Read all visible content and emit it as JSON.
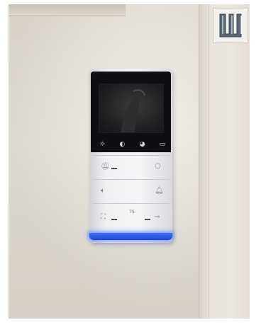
{
  "photo": {
    "logo_icon": "w-monogram-icon",
    "brand_mark": "TS"
  },
  "intercom": {
    "display_icons": [
      "brightness-icon",
      "contrast-icon",
      "color-icon",
      "aspect-icon"
    ],
    "keys": [
      {
        "left_icon": "bell-mute-icon",
        "right_icon": "circle-icon"
      },
      {
        "left_icon": "volume-icon",
        "right_icon": "bell-icon"
      },
      {
        "left_icon": "door-release-icon",
        "right_icon": "key-icon"
      }
    ],
    "led_color": "#2f5ff0"
  }
}
